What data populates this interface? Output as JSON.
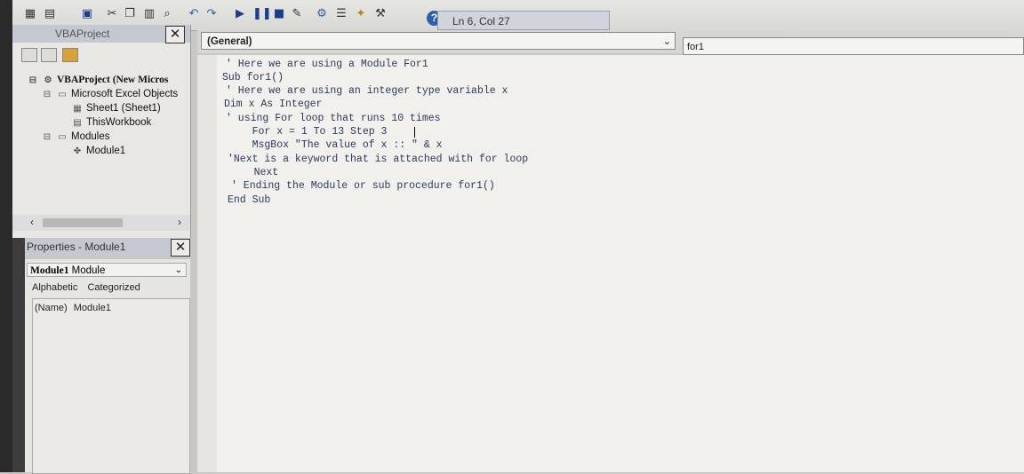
{
  "toolbar": {
    "status": "Ln 6, Col 27"
  },
  "project": {
    "title": "VBAProject",
    "tree": [
      {
        "label": "VBAProject (New Micros",
        "level": 0,
        "icon": "project-icon"
      },
      {
        "label": "Microsoft Excel Objects",
        "level": 1,
        "icon": "folder-icon"
      },
      {
        "label": "Sheet1 (Sheet1)",
        "level": 2,
        "icon": "sheet-icon"
      },
      {
        "label": "ThisWorkbook",
        "level": 2,
        "icon": "workbook-icon"
      },
      {
        "label": "Modules",
        "level": 1,
        "icon": "folder-icon"
      },
      {
        "label": "Module1",
        "level": 2,
        "icon": "module-icon"
      }
    ]
  },
  "properties": {
    "title": "Properties - Module1",
    "selector_name": "Module1",
    "selector_type": "Module",
    "tab_alphabetic": "Alphabetic",
    "tab_categorized": "Categorized",
    "row_name": "(Name)",
    "row_value": "Module1"
  },
  "code": {
    "object_combo": "(General)",
    "procedure_combo": "for1",
    "lines": [
      "' Here we are using a Module For1",
      "Sub for1()",
      "' Here we are using an integer type variable x",
      "Dim x As Integer",
      "' using For loop that runs 10 times",
      "    For x = 1 To 13 Step 3",
      "    MsgBox \"The value of x :: \" & x",
      "'Next is a keyword that is attached with for loop",
      "    Next",
      "' Ending the Module or sub procedure for1()",
      "End Sub"
    ]
  }
}
